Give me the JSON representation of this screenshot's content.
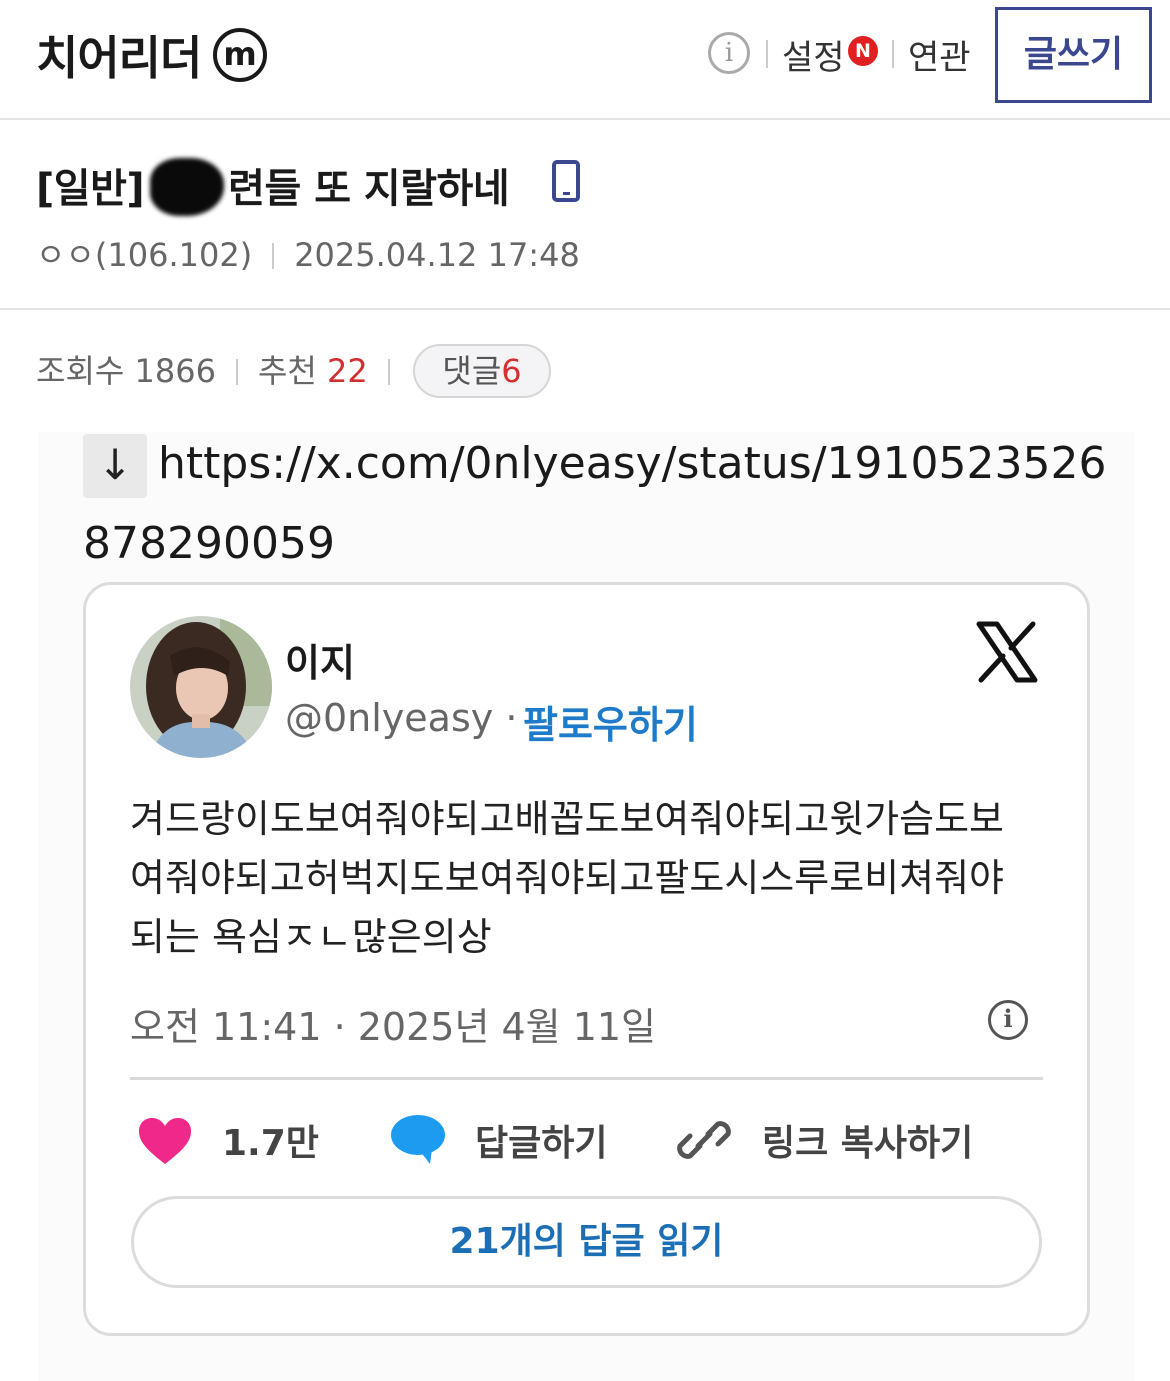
{
  "header": {
    "gallery_title": "치어리더",
    "minor_badge": "m",
    "info_icon": "info-icon",
    "settings_label": "설정",
    "new_badge": "N",
    "related_label": "연관",
    "write_label": "글쓰기"
  },
  "post": {
    "title_prefix": "[일반]",
    "title_rest": "련들 또 지랄하네",
    "author": "ㅇㅇ(106.102)",
    "date": "2025.04.12 17:48",
    "views_label": "조회수",
    "views": "1866",
    "recommend_label": "추천",
    "recommend_count": "22",
    "comments_label": "댓글",
    "comments_count": "6"
  },
  "body": {
    "url_part1": "https://x.com/0nlyeasy/status/1910523526",
    "url_part2": "878290059"
  },
  "tweet": {
    "name": "이지",
    "handle": "@0nlyeasy",
    "dot": " · ",
    "follow_label": "팔로우하기",
    "text": "겨드랑이도보여줘야되고배꼽도보여줘야되고윗가슴도보여줘야되고허벅지도보여줘야되고팔도시스루로비쳐줘야되는 욕심ㅈㄴ많은의상",
    "time": "오전 11:41 · 2025년 4월 11일",
    "likes": "1.7만",
    "reply_label": "답글하기",
    "copy_link_label": "링크 복사하기",
    "read_replies_label": "21개의 답글 읽기"
  },
  "colors": {
    "brand_navy": "#3b4890",
    "accent_red": "#d32f2f",
    "twitter_blue": "#1d7bc9",
    "heart_pink": "#f0288a"
  }
}
